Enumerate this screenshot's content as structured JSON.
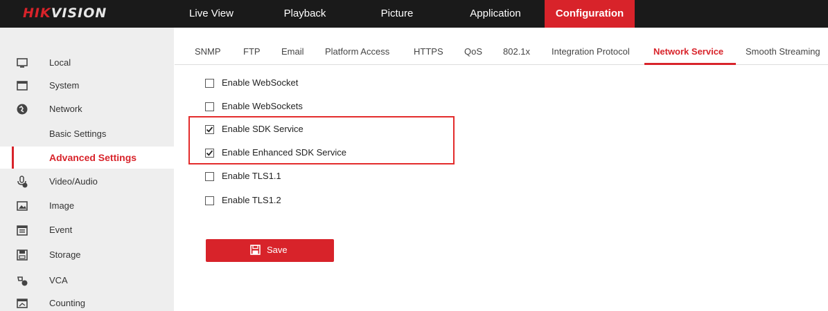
{
  "header": {
    "logo_hik": "HIK",
    "logo_vision": "VISION",
    "nav": [
      {
        "label": "Live View"
      },
      {
        "label": "Playback"
      },
      {
        "label": "Picture"
      },
      {
        "label": "Application"
      },
      {
        "label": "Configuration",
        "active": true
      }
    ]
  },
  "sidebar": {
    "items": [
      {
        "label": "Local",
        "icon": "monitor-icon"
      },
      {
        "label": "System",
        "icon": "system-icon"
      },
      {
        "label": "Network",
        "icon": "network-icon"
      },
      {
        "label": "Basic Settings",
        "sub": true
      },
      {
        "label": "Advanced Settings",
        "sub": true,
        "active": true
      },
      {
        "label": "Video/Audio",
        "icon": "microphone-icon"
      },
      {
        "label": "Image",
        "icon": "image-icon"
      },
      {
        "label": "Event",
        "icon": "calendar-icon"
      },
      {
        "label": "Storage",
        "icon": "disk-icon"
      },
      {
        "label": "VCA",
        "icon": "vca-icon"
      },
      {
        "label": "Counting",
        "icon": "counting-icon"
      }
    ]
  },
  "tabs": [
    {
      "label": "SNMP"
    },
    {
      "label": "FTP"
    },
    {
      "label": "Email"
    },
    {
      "label": "Platform Access"
    },
    {
      "label": "HTTPS"
    },
    {
      "label": "QoS"
    },
    {
      "label": "802.1x"
    },
    {
      "label": "Integration Protocol"
    },
    {
      "label": "Network Service",
      "active": true
    },
    {
      "label": "Smooth Streaming"
    }
  ],
  "options": [
    {
      "label": "Enable WebSocket",
      "checked": false
    },
    {
      "label": "Enable WebSockets",
      "checked": false
    },
    {
      "label": "Enable SDK Service",
      "checked": true
    },
    {
      "label": "Enable Enhanced SDK Service",
      "checked": true
    },
    {
      "label": "Enable TLS1.1",
      "checked": false
    },
    {
      "label": "Enable TLS1.2",
      "checked": false
    }
  ],
  "save_button": {
    "label": "Save",
    "icon": "floppy-disk-icon"
  },
  "colors": {
    "accent": "#d8232a",
    "topbar": "#1a1a1a",
    "sidebar": "#eeeeee",
    "highlight": "#e32b2b"
  }
}
